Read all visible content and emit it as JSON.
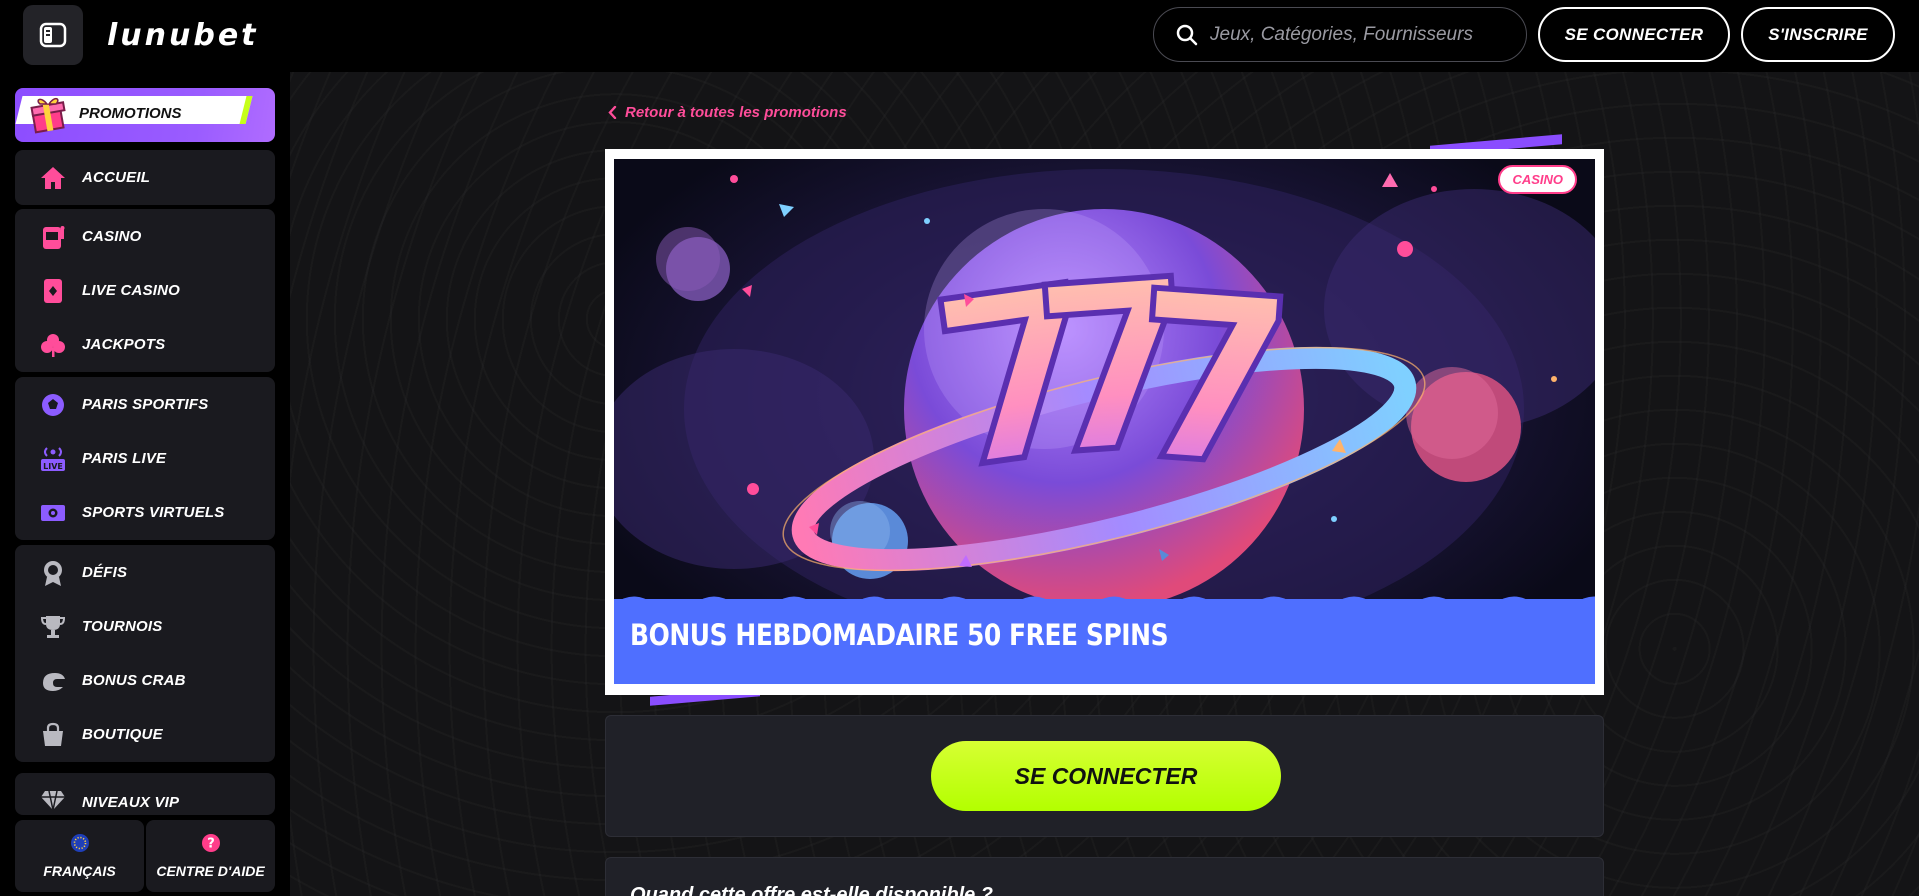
{
  "header": {
    "logo": "LUNUBET",
    "search_placeholder": "Jeux, Catégories, Fournisseurs",
    "login_label": "SE CONNECTER",
    "signup_label": "S'INSCRIRE"
  },
  "sidebar": {
    "promo_label": "PROMOTIONS",
    "items": [
      {
        "label": "ACCUEIL",
        "icon": "home-icon"
      },
      {
        "label": "CASINO",
        "icon": "slot-machine-icon"
      },
      {
        "label": "LIVE CASINO",
        "icon": "playing-card-icon"
      },
      {
        "label": "JACKPOTS",
        "icon": "clover-icon"
      },
      {
        "label": "PARIS SPORTIFS",
        "icon": "soccer-ball-icon"
      },
      {
        "label": "PARIS LIVE",
        "icon": "live-broadcast-icon"
      },
      {
        "label": "SPORTS VIRTUELS",
        "icon": "virtual-screen-icon"
      },
      {
        "label": "DÉFIS",
        "icon": "badge-icon"
      },
      {
        "label": "TOURNOIS",
        "icon": "trophy-icon"
      },
      {
        "label": "BONUS CRAB",
        "icon": "crab-icon"
      },
      {
        "label": "BOUTIQUE",
        "icon": "shopping-bag-icon"
      },
      {
        "label": "NIVEAUX VIP",
        "icon": "diamond-icon"
      }
    ],
    "language_label": "FRANÇAIS",
    "help_label": "CENTRE D'AIDE"
  },
  "main": {
    "back_link": "Retour à toutes les promotions",
    "badge": "CASINO",
    "banner_title": "BONUS HEBDOMADAIRE 50 FREE SPINS",
    "cta_label": "SE CONNECTER",
    "info_title": "Quand cette offre est-elle disponible ?"
  },
  "colors": {
    "accent_pink": "#ff4d9a",
    "accent_purple": "#8c4dff",
    "cta_green": "#c6ff1a",
    "banner_blue": "#4f6fff"
  }
}
